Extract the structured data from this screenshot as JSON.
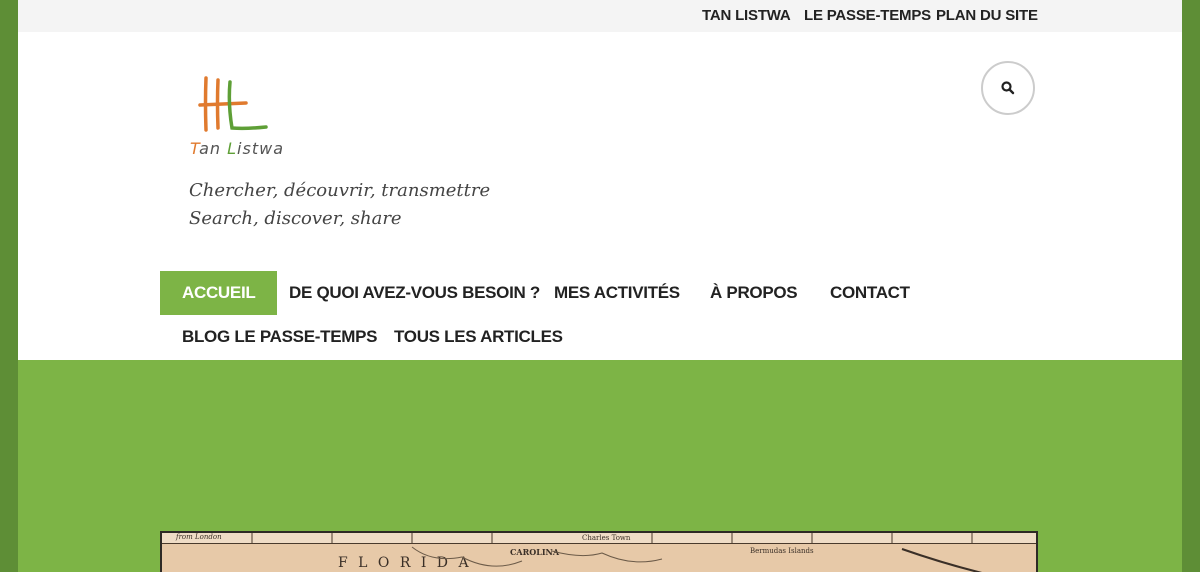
{
  "topbar": {
    "links": [
      "TAN LISTWA",
      "LE PASSE-TEMPS",
      "PLAN DU SITE"
    ]
  },
  "header": {
    "logo_text": "Tan Listwa",
    "tagline_fr": "Chercher, découvrir, transmettre",
    "tagline_en": "Search, discover, share",
    "search_icon": "search-icon"
  },
  "nav": {
    "items": [
      {
        "label": "ACCUEIL",
        "active": true
      },
      {
        "label": "DE QUOI AVEZ-VOUS BESOIN ?",
        "active": false
      },
      {
        "label": "MES ACTIVITÉS",
        "active": false
      },
      {
        "label": "À PROPOS",
        "active": false
      },
      {
        "label": "CONTACT",
        "active": false
      },
      {
        "label": "BLOG LE PASSE-TEMPS",
        "active": false
      },
      {
        "label": "TOUS LES ARTICLES",
        "active": false
      }
    ]
  },
  "hero": {
    "map_labels": {
      "london": "from London",
      "charles_town": "Charles Town",
      "carolina": "CAROLINA",
      "bermudas": "Bermudas Islands",
      "florida": "F L O R I D A"
    }
  },
  "colors": {
    "accent": "#7db446",
    "frame": "#5e8e36",
    "topbar_bg": "#f4f4f4",
    "map_paper": "#e7c9a8"
  }
}
